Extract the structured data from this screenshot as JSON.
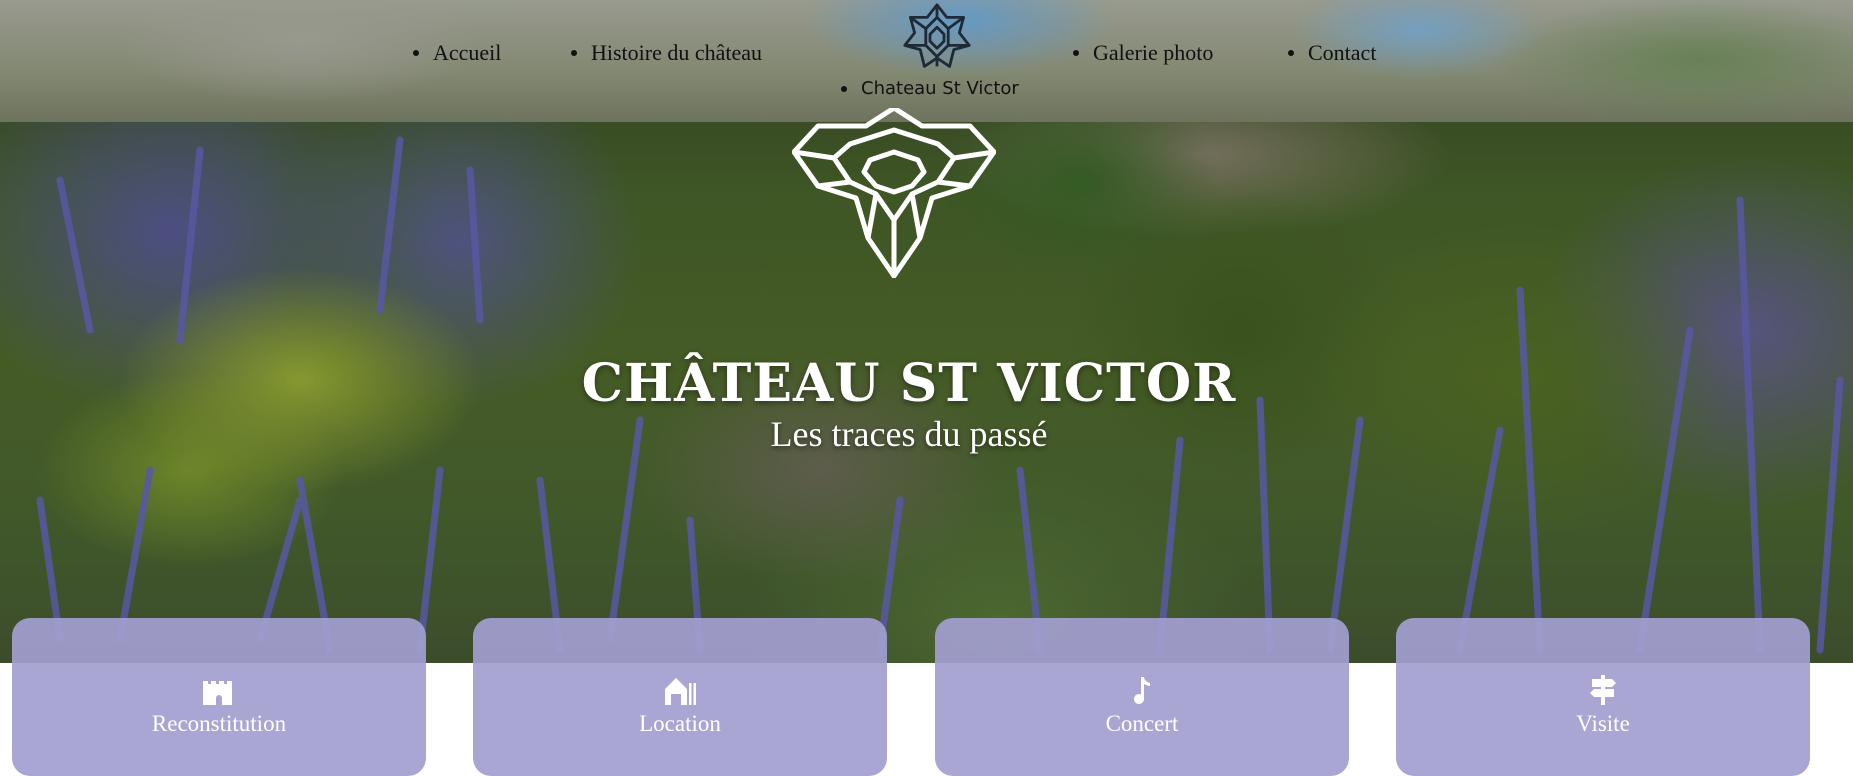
{
  "nav": {
    "items": [
      {
        "label": "Accueil"
      },
      {
        "label": "Histoire du château"
      },
      {
        "label": "Galerie photo"
      },
      {
        "label": "Contact"
      }
    ],
    "home_label": "Chateau St Victor"
  },
  "hero": {
    "title": "CHÂTEAU ST VICTOR",
    "subtitle": "Les traces du passé"
  },
  "cards": [
    {
      "label": "Reconstitution",
      "icon": "castle-icon"
    },
    {
      "label": "Location",
      "icon": "barn-icon"
    },
    {
      "label": "Concert",
      "icon": "music-note-icon"
    },
    {
      "label": "Visite",
      "icon": "signpost-icon"
    }
  ],
  "colors": {
    "card_bg": "#A39ED0",
    "text_light": "#FFFFFF",
    "nav_text": "#111111"
  }
}
